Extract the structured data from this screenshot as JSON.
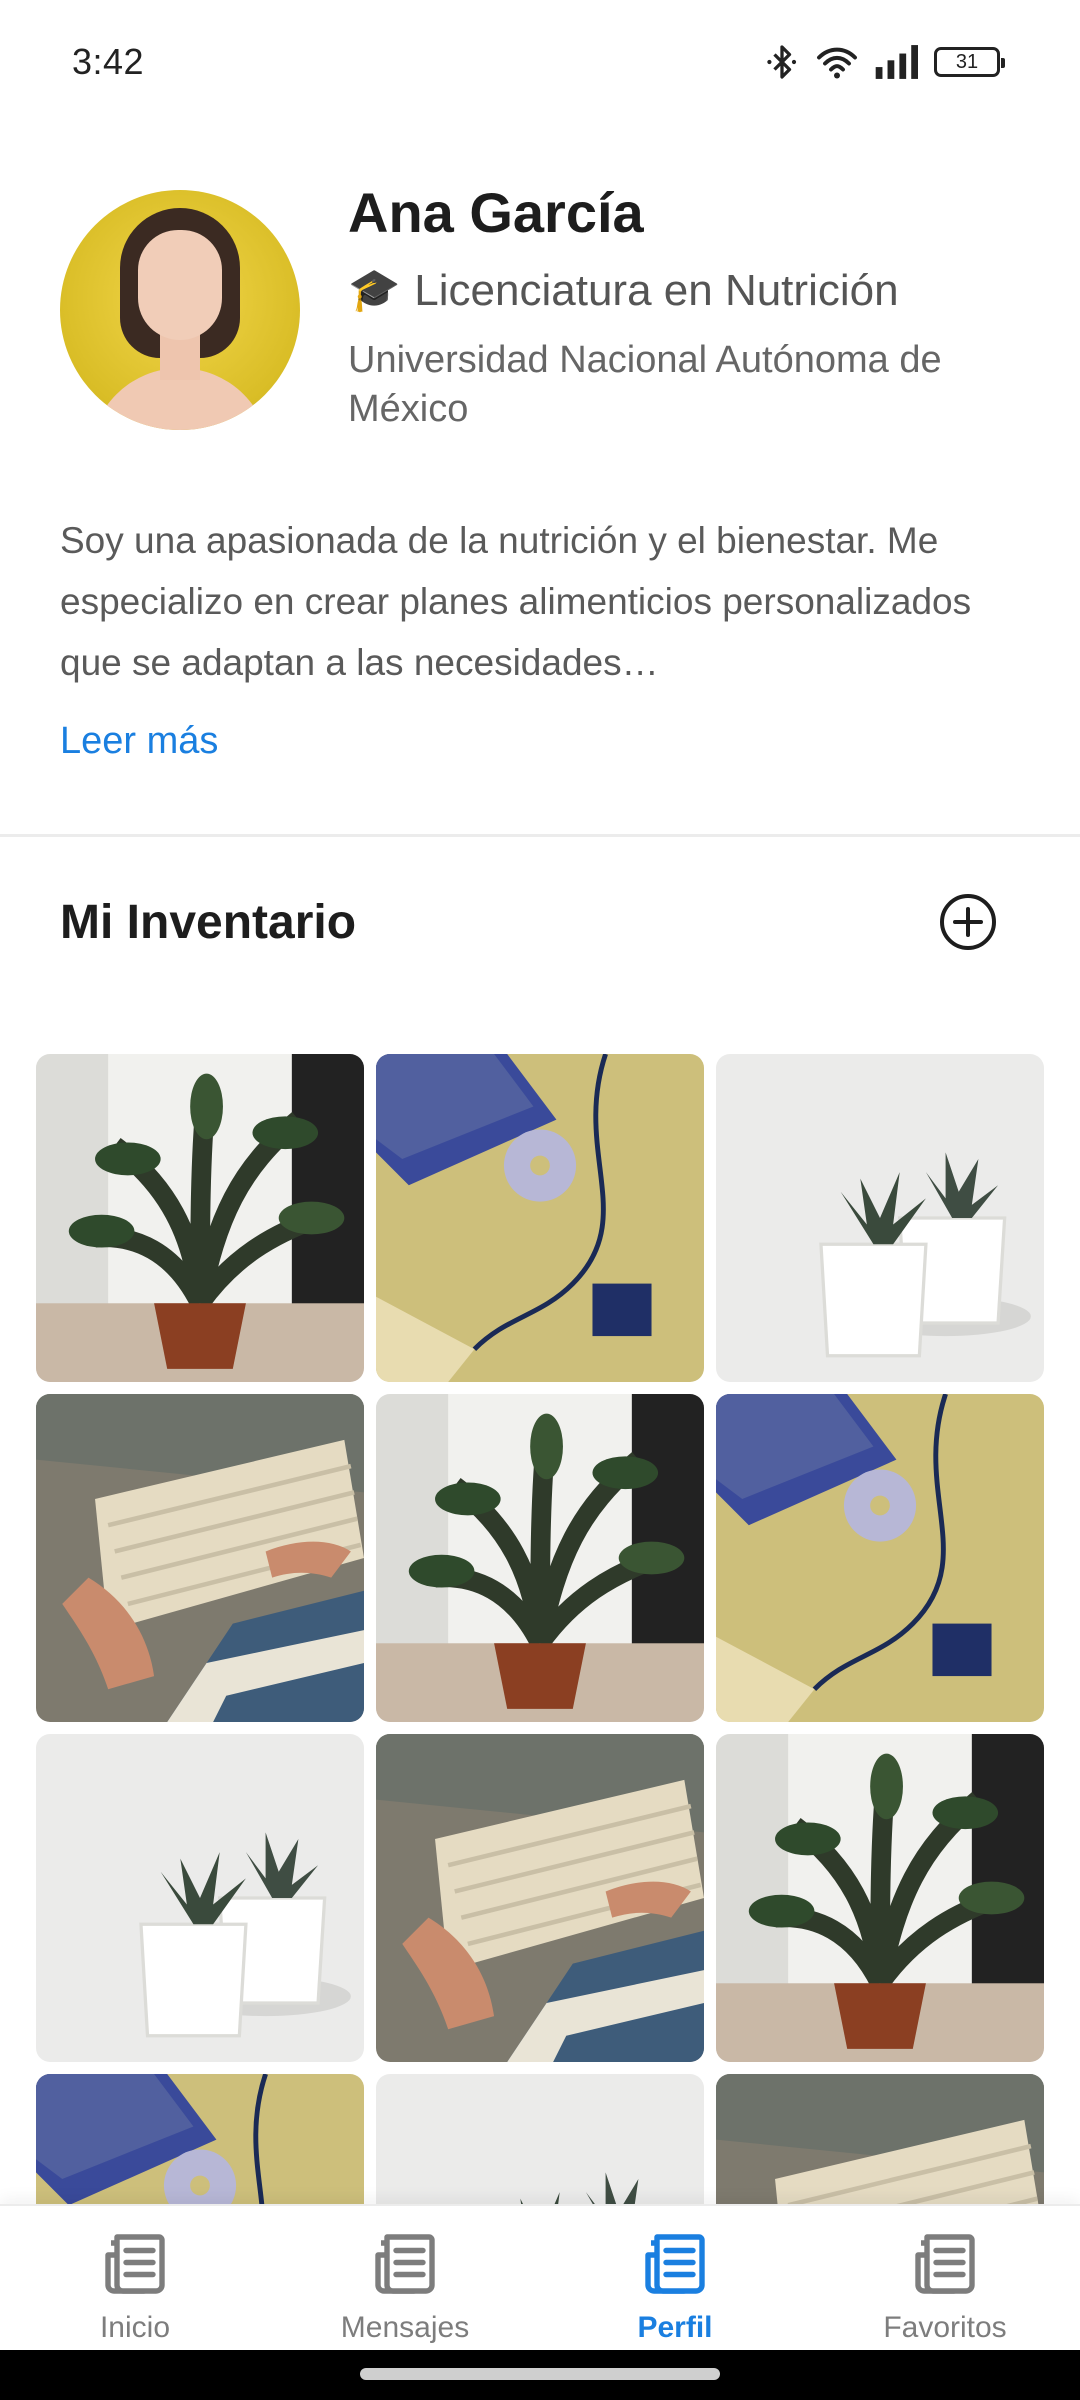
{
  "status_bar": {
    "time": "3:42",
    "battery": "31",
    "icons": [
      "bluetooth-icon",
      "wifi-icon",
      "signal-icon",
      "battery-icon"
    ]
  },
  "profile": {
    "name": "Ana García",
    "degree_icon": "🎓",
    "degree": "Licenciatura en Nutrición",
    "university": "Universidad Nacional Autónoma de México",
    "bio": "Soy una apasionada de la nutrición y el bienestar. Me especializo en crear planes alimenticios personalizados que se adaptan a las necesidades…",
    "read_more": "Leer más"
  },
  "inventory": {
    "title": "Mi Inventario",
    "add_icon": "add-circle-icon",
    "items": [
      "plant",
      "desk",
      "succulents",
      "keyboard",
      "plant",
      "desk",
      "succulents",
      "keyboard",
      "plant",
      "desk",
      "succulents",
      "keyboard"
    ]
  },
  "nav": {
    "items": [
      {
        "label": "Inicio",
        "icon": "newspaper-icon",
        "active": false
      },
      {
        "label": "Mensajes",
        "icon": "newspaper-icon",
        "active": false
      },
      {
        "label": "Perfil",
        "icon": "newspaper-icon",
        "active": true
      },
      {
        "label": "Favoritos",
        "icon": "newspaper-icon",
        "active": false
      }
    ]
  },
  "colors": {
    "accent": "#1a7fe0",
    "text_primary": "#1d1d1d",
    "text_secondary": "#5a5a5a",
    "nav_inactive": "#7d7d7d"
  }
}
